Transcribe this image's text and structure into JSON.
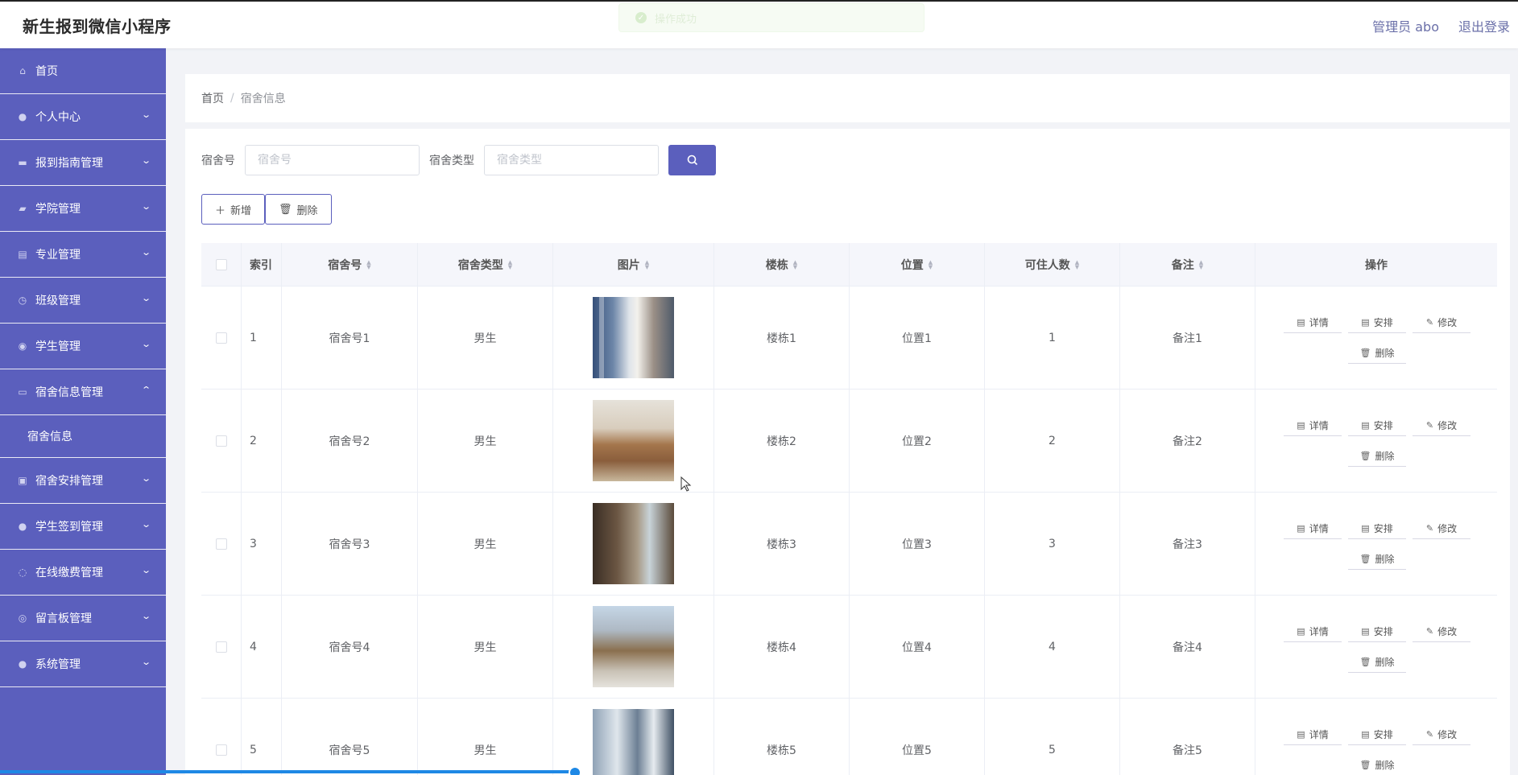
{
  "app": {
    "title": "新生报到微信小程序",
    "user_label": "管理员 abo",
    "logout_label": "退出登录"
  },
  "toast": {
    "message": "操作成功"
  },
  "sidebar": {
    "items": [
      {
        "label": "首页",
        "icon": "home-icon"
      },
      {
        "label": "个人中心",
        "icon": "user-icon"
      },
      {
        "label": "报到指南管理",
        "icon": "guide-icon"
      },
      {
        "label": "学院管理",
        "icon": "college-icon"
      },
      {
        "label": "专业管理",
        "icon": "clipboard-icon"
      },
      {
        "label": "班级管理",
        "icon": "clock-icon"
      },
      {
        "label": "学生管理",
        "icon": "location-icon"
      },
      {
        "label": "宿舍信息管理",
        "icon": "message-icon"
      },
      {
        "label": "宿舍安排管理",
        "icon": "ticket-icon"
      },
      {
        "label": "学生签到管理",
        "icon": "user-icon"
      },
      {
        "label": "在线缴费管理",
        "icon": "compass-icon"
      },
      {
        "label": "留言板管理",
        "icon": "circle-icon"
      },
      {
        "label": "系统管理",
        "icon": "user-icon"
      }
    ],
    "sub_item": "宿舍信息"
  },
  "breadcrumb": {
    "home": "首页",
    "sep": "/",
    "current": "宿舍信息"
  },
  "search": {
    "dorm_no_label": "宿舍号",
    "dorm_no_placeholder": "宿舍号",
    "dorm_type_label": "宿舍类型",
    "dorm_type_placeholder": "宿舍类型"
  },
  "actions": {
    "add": "新增",
    "delete": "删除"
  },
  "table": {
    "headers": {
      "index": "索引",
      "dorm_no": "宿舍号",
      "dorm_type": "宿舍类型",
      "image": "图片",
      "building": "楼栋",
      "position": "位置",
      "capacity": "可住人数",
      "remark": "备注",
      "ops": "操作"
    },
    "op_labels": {
      "detail": "详情",
      "arrange": "安排",
      "edit": "修改",
      "delete": "删除"
    },
    "rows": [
      {
        "index": "1",
        "dorm_no": "宿舍号1",
        "dorm_type": "男生",
        "building": "楼栋1",
        "position": "位置1",
        "capacity": "1",
        "remark": "备注1"
      },
      {
        "index": "2",
        "dorm_no": "宿舍号2",
        "dorm_type": "男生",
        "building": "楼栋2",
        "position": "位置2",
        "capacity": "2",
        "remark": "备注2"
      },
      {
        "index": "3",
        "dorm_no": "宿舍号3",
        "dorm_type": "男生",
        "building": "楼栋3",
        "position": "位置3",
        "capacity": "3",
        "remark": "备注3"
      },
      {
        "index": "4",
        "dorm_no": "宿舍号4",
        "dorm_type": "男生",
        "building": "楼栋4",
        "position": "位置4",
        "capacity": "4",
        "remark": "备注4"
      },
      {
        "index": "5",
        "dorm_no": "宿舍号5",
        "dorm_type": "男生",
        "building": "楼栋5",
        "position": "位置5",
        "capacity": "5",
        "remark": "备注5"
      }
    ]
  },
  "colors": {
    "accent": "#5b5fbd",
    "progress": "#1e88e5"
  }
}
